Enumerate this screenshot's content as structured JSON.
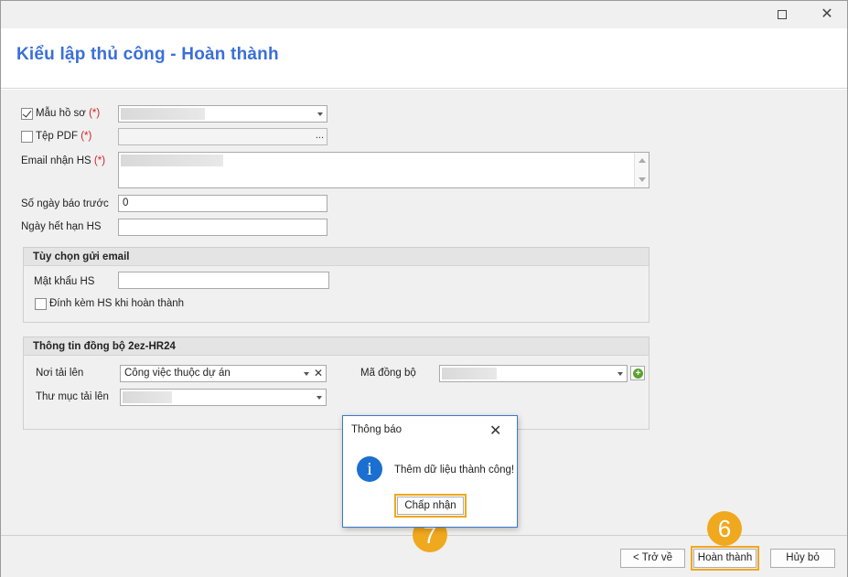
{
  "window": {
    "title": "Kiểu lập thủ công - Hoàn thành"
  },
  "form": {
    "mau_ho_so": {
      "label": "Mẫu hồ sơ",
      "required": "(*)",
      "checked": true
    },
    "tep_pdf": {
      "label": "Tệp PDF",
      "required": "(*)",
      "checked": false,
      "browse": "..."
    },
    "email_nhan": {
      "label": "Email nhận HS",
      "required": "(*)"
    },
    "so_ngay_bao_truoc": {
      "label": "Số ngày báo trước",
      "value": "0"
    },
    "ngay_het_han": {
      "label": "Ngày hết hạn HS",
      "value": ""
    }
  },
  "email_options": {
    "title": "Tùy chọn gửi email",
    "password_label": "Mật khẩu HS",
    "attach_label": "Đính kèm HS khi hoàn thành",
    "attach_checked": false
  },
  "sync": {
    "title": "Thông tin đồng bộ 2ez-HR24",
    "noi_tai_len_label": "Nơi tải lên",
    "noi_tai_len_value": "Công việc thuộc dự án",
    "ma_dong_bo_label": "Mã đồng bộ",
    "thu_muc_label": "Thư mục tải lên"
  },
  "footer": {
    "back": "< Trở về",
    "finish": "Hoàn thành",
    "cancel": "Hủy bỏ"
  },
  "dialog": {
    "title": "Thông báo",
    "message": "Thêm dữ liệu thành công!",
    "accept": "Chấp nhận"
  },
  "annotations": {
    "step_finish": "6",
    "step_accept": "7"
  },
  "colors": {
    "title_blue": "#3a6fd8",
    "required_red": "#d62020",
    "highlight_orange": "#f0a81e",
    "info_blue": "#1a6fd0"
  },
  "icons": {
    "maximize": "maximize-icon",
    "close": "close-icon",
    "info": "info-icon",
    "add": "add-icon"
  }
}
